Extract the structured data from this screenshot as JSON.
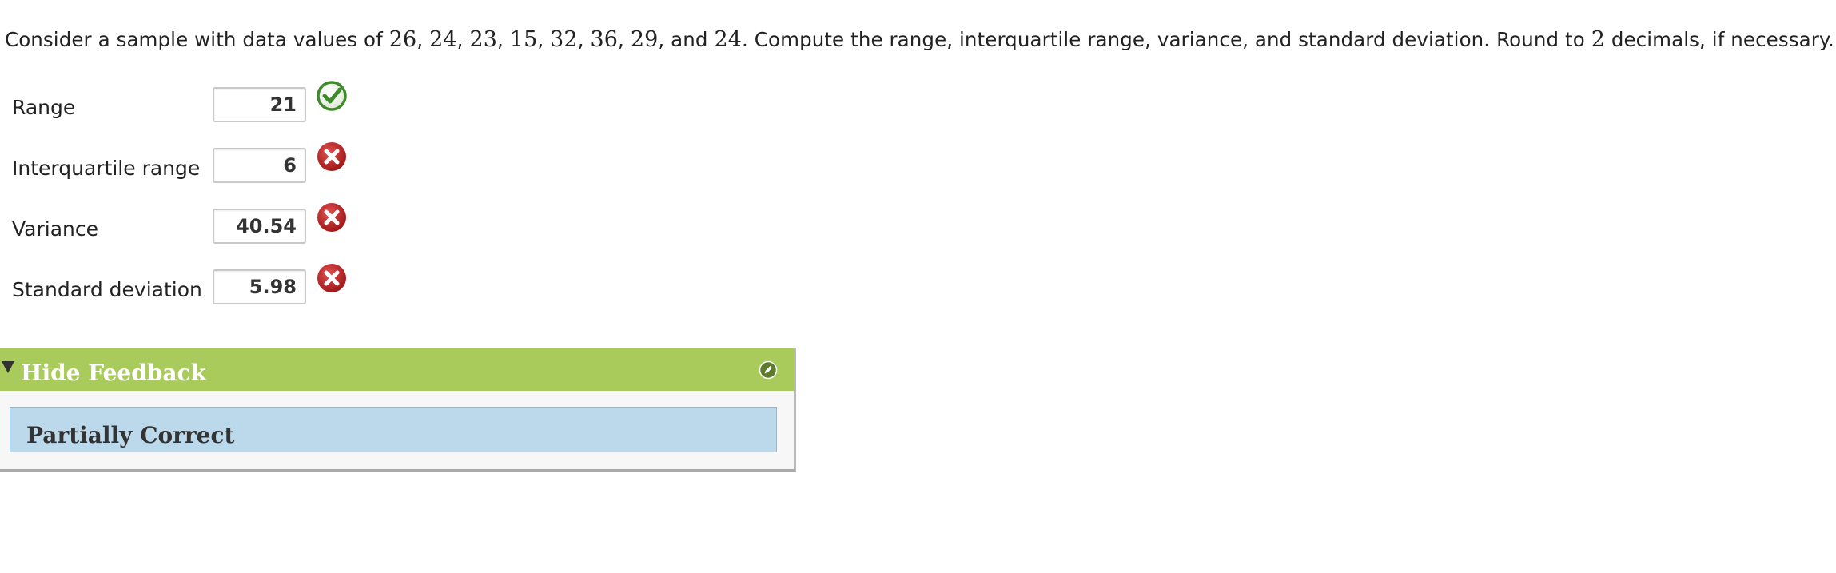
{
  "question": {
    "intro": "Consider a sample with data values of ",
    "values": [
      "26",
      "24",
      "23",
      "15",
      "32",
      "36",
      "29",
      "24"
    ],
    "conjunction": "and",
    "instruction": ". Compute the range, interquartile range, variance, and standard deviation. Round to ",
    "decimals": "2",
    "suffix": " decimals, if necessary."
  },
  "answers": [
    {
      "label": "Range",
      "value": "21",
      "status": "correct",
      "icon": "check-icon"
    },
    {
      "label": "Interquartile range",
      "value": "6",
      "status": "incorrect",
      "icon": "x-icon"
    },
    {
      "label": "Variance",
      "value": "40.54",
      "status": "incorrect",
      "icon": "x-icon"
    },
    {
      "label": "Standard deviation",
      "value": "5.98",
      "status": "incorrect",
      "icon": "x-icon"
    }
  ],
  "feedback": {
    "toggle_label": "Hide Feedback",
    "result": "Partially Correct"
  },
  "colors": {
    "feedback_header": "#a9cb5b",
    "result_box": "#bbd9ea",
    "correct": "#3f8a2a",
    "incorrect": "#b21f1f"
  }
}
